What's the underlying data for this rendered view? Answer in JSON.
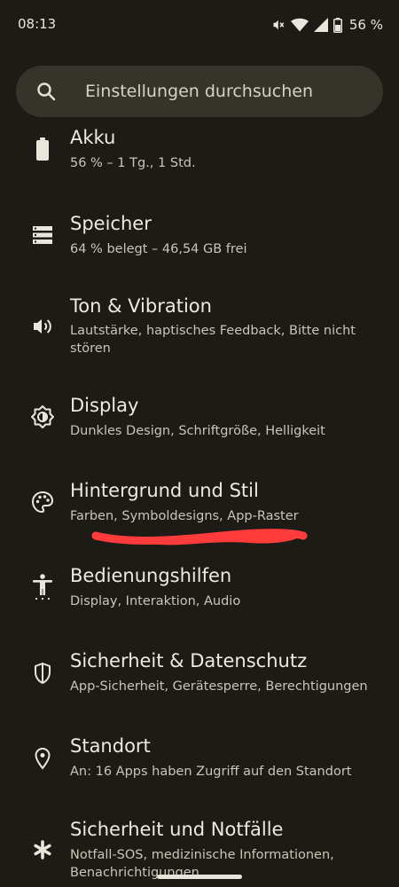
{
  "status_bar": {
    "time": "08:13",
    "battery_percent": "56 %",
    "icons": [
      "mute-icon",
      "wifi-icon",
      "signal-icon",
      "battery-icon"
    ]
  },
  "search": {
    "placeholder": "Einstellungen durchsuchen",
    "icon": "search-icon"
  },
  "items": [
    {
      "title": "Akku",
      "subtitle": "56 % – 1 Tg., 1 Std.",
      "icon": "battery-icon"
    },
    {
      "title": "Speicher",
      "subtitle": "64 % belegt – 46,54 GB frei",
      "icon": "storage-icon"
    },
    {
      "title": "Ton & Vibration",
      "subtitle": "Lautstärke, haptisches Feedback, Bitte nicht stören",
      "icon": "volume-icon"
    },
    {
      "title": "Display",
      "subtitle": "Dunkles Design, Schriftgröße, Helligkeit",
      "icon": "brightness-icon"
    },
    {
      "title": "Hintergrund und Stil",
      "subtitle": "Farben, Symboldesigns, App-Raster",
      "icon": "palette-icon"
    },
    {
      "title": "Bedienungshilfen",
      "subtitle": "Display, Interaktion, Audio",
      "icon": "accessibility-icon"
    },
    {
      "title": "Sicherheit & Datenschutz",
      "subtitle": "App-Sicherheit, Gerätesperre, Berechtigungen",
      "icon": "shield-icon"
    },
    {
      "title": "Standort",
      "subtitle": "An: 16 Apps haben Zugriff auf den Standort",
      "icon": "location-icon"
    },
    {
      "title": "Sicherheit und Notfälle",
      "subtitle": "Notfall-SOS, medizinische Informationen, Benachrichtigungen",
      "icon": "emergency-icon"
    }
  ],
  "annotation_color": "#ff3b3b",
  "colors": {
    "background": "#1c1b16",
    "search_bg": "#35332a"
  }
}
